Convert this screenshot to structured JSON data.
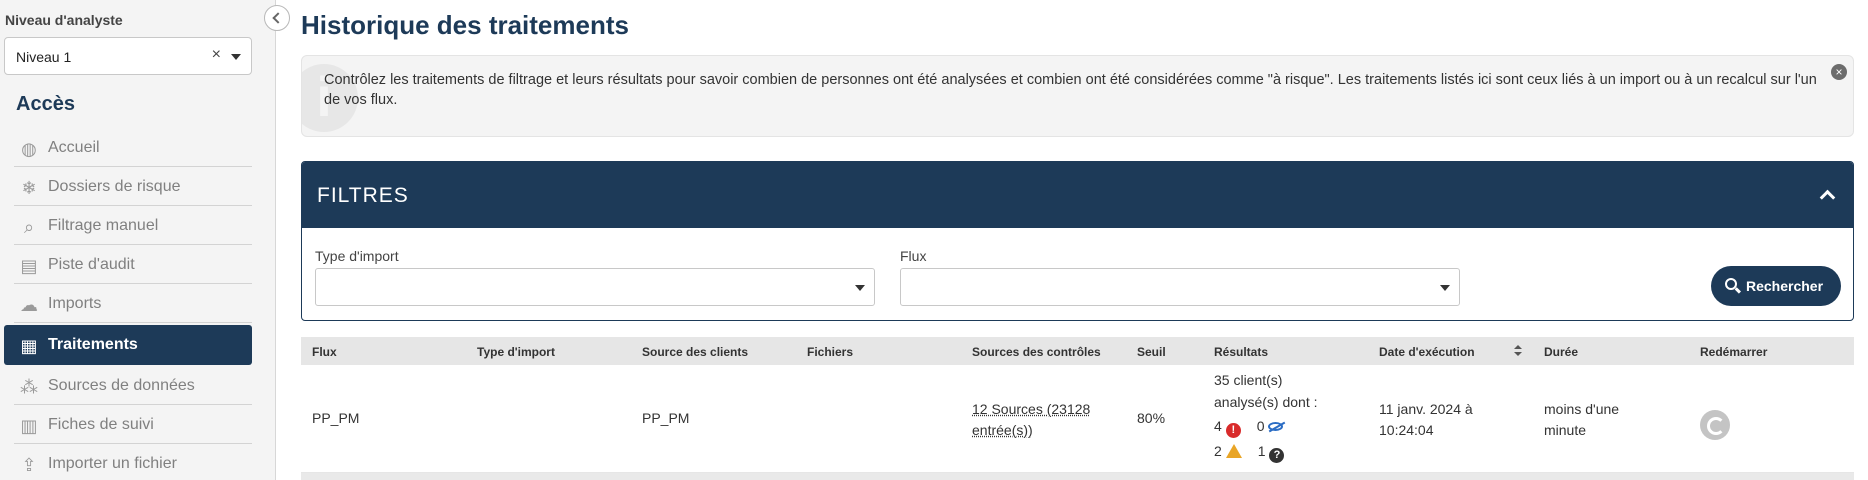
{
  "sidebar": {
    "analyst_label": "Niveau d'analyste",
    "analyst_value": "Niveau 1",
    "clear_symbol": "×",
    "section_title": "Accès",
    "items": [
      {
        "label": "Accueil",
        "icon": "globe-icon",
        "glyph": "◍",
        "active": false
      },
      {
        "label": "Dossiers de risque",
        "icon": "snowflake-icon",
        "glyph": "❄",
        "active": false
      },
      {
        "label": "Filtrage manuel",
        "icon": "magnifier-icon",
        "glyph": "⌕",
        "active": false
      },
      {
        "label": "Piste d'audit",
        "icon": "audit-doc-icon",
        "glyph": "▤",
        "active": false
      },
      {
        "label": "Imports",
        "icon": "cloud-icon",
        "glyph": "☁",
        "active": false
      },
      {
        "label": "Traitements",
        "icon": "grid-icon",
        "glyph": "▦",
        "active": true
      },
      {
        "label": "Sources de données",
        "icon": "nodes-icon",
        "glyph": "⁂",
        "active": false
      },
      {
        "label": "Fiches de suivi",
        "icon": "clipboard-icon",
        "glyph": "▥",
        "active": false
      },
      {
        "label": "Importer un fichier",
        "icon": "upload-icon",
        "glyph": "⇪",
        "active": false
      }
    ]
  },
  "main": {
    "title": "Historique des traitements",
    "info_text": "Contrôlez les traitements de filtrage et leurs résultats pour savoir combien de personnes ont été analysées et combien ont été considérées comme \"à risque\". Les traitements listés ici sont ceux liés à un import ou à un recalcul sur l'un de vos flux.",
    "info_icon": "i",
    "close_symbol": "×",
    "filters": {
      "title": "FILTRES",
      "type_import_label": "Type d'import",
      "type_import_value": "",
      "flux_label": "Flux",
      "flux_value": "",
      "search_label": "Rechercher"
    },
    "table": {
      "columns": [
        "Flux",
        "Type d'import",
        "Source des clients",
        "Fichiers",
        "Sources des contrôles",
        "Seuil",
        "Résultats",
        "Date d'exécution",
        "Durée",
        "Redémarrer"
      ],
      "rows": [
        {
          "flux": "PP_PM",
          "type_import": "",
          "source_clients": "PP_PM",
          "fichiers": "",
          "sources_controles_line1": "12 Sources (23128",
          "sources_controles_line2": "entrée(s))",
          "seuil": "80%",
          "resultats_line1": "35 client(s)",
          "resultats_line2": "analysé(s) dont :",
          "count_risk": "4",
          "count_hidden": "0",
          "count_warning": "2",
          "count_unknown": "1",
          "date_line1": "11 janv. 2024 à",
          "date_line2": "10:24:04",
          "duree_line1": "moins d'une",
          "duree_line2": "minute"
        }
      ]
    }
  }
}
